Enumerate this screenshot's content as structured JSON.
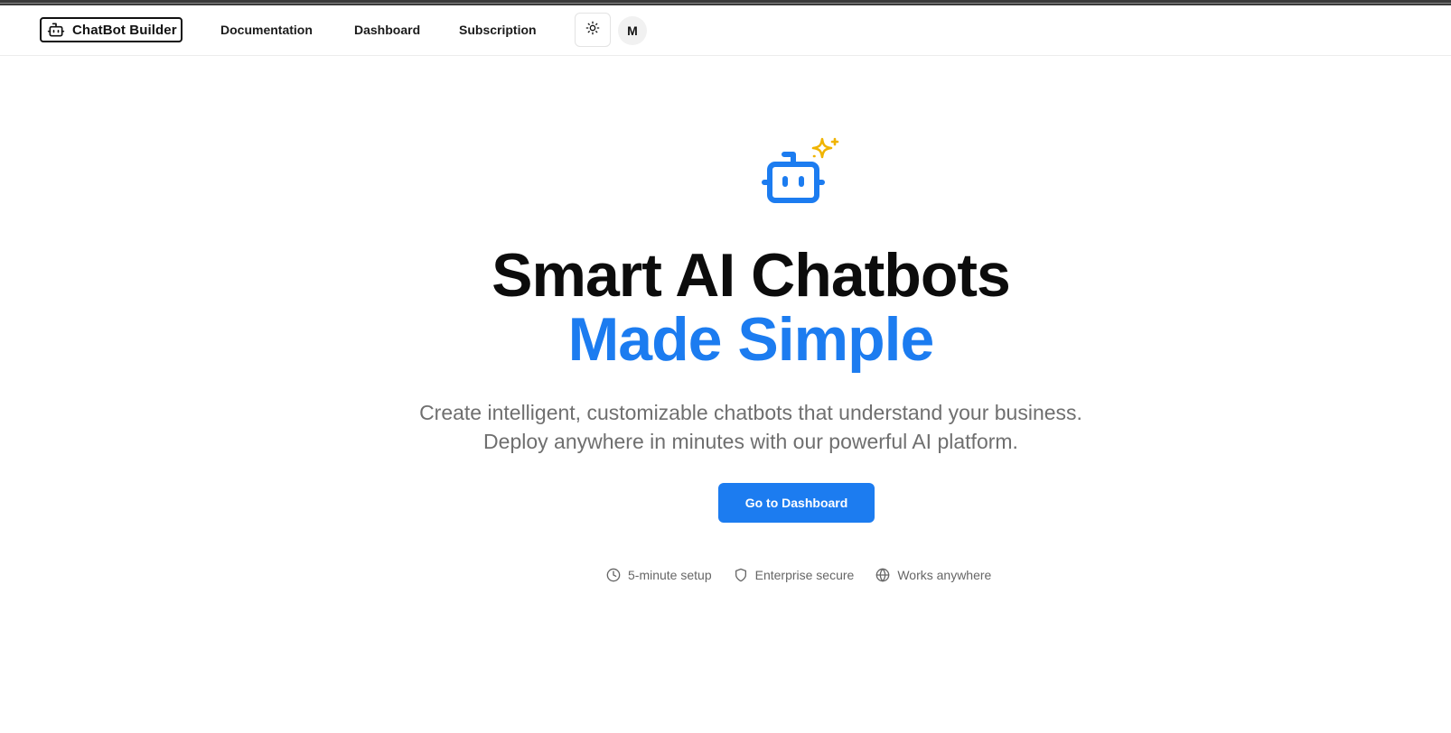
{
  "brand": {
    "name": "ChatBot Builder",
    "icon": "bot-icon"
  },
  "nav": {
    "links": [
      {
        "label": "Documentation"
      },
      {
        "label": "Dashboard"
      },
      {
        "label": "Subscription"
      }
    ],
    "theme_toggle_icon": "sun-icon",
    "avatar_initial": "M"
  },
  "hero": {
    "icon": "bot-sparkles-icon",
    "headline_line1": "Smart AI Chatbots",
    "headline_line2": "Made Simple",
    "subtitle_line1": "Create intelligent, customizable chatbots that understand your business.",
    "subtitle_line2": "Deploy anywhere in minutes with our powerful AI platform.",
    "cta_label": "Go to Dashboard"
  },
  "features": [
    {
      "icon": "clock-icon",
      "label": "5-minute setup"
    },
    {
      "icon": "shield-icon",
      "label": "Enterprise secure"
    },
    {
      "icon": "globe-icon",
      "label": "Works anywhere"
    }
  ],
  "colors": {
    "accent": "#1c7cf0",
    "sparkle": "#f0b400",
    "heading": "#0c0c0c",
    "muted": "#6f6f6f"
  }
}
